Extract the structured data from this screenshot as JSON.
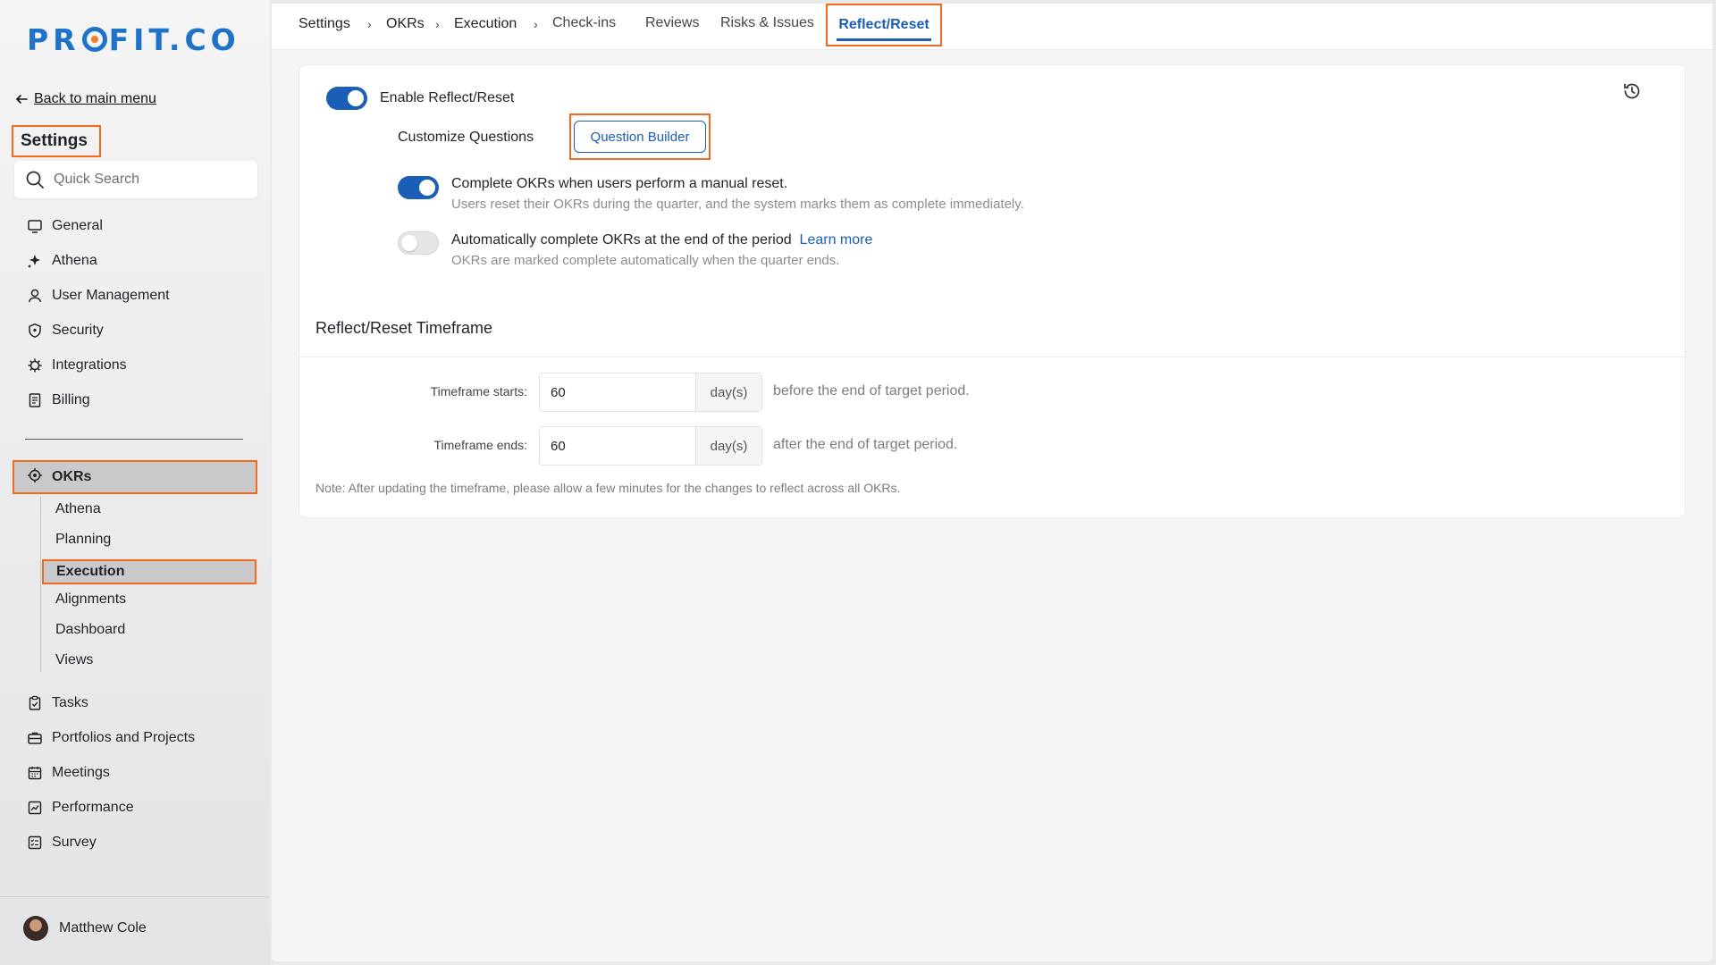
{
  "brand": {
    "logo_left": "PR",
    "logo_right": "FIT.CO"
  },
  "sidebar": {
    "back_label": "Back to main menu",
    "section_title": "Settings",
    "search_placeholder": "Quick Search",
    "items": [
      {
        "label": "General",
        "icon": "monitor-icon"
      },
      {
        "label": "Athena",
        "icon": "sparkle-icon"
      },
      {
        "label": "User Management",
        "icon": "user-icon"
      },
      {
        "label": "Security",
        "icon": "shield-icon"
      },
      {
        "label": "Integrations",
        "icon": "gear-icon"
      },
      {
        "label": "Billing",
        "icon": "receipt-icon"
      }
    ],
    "okrs": {
      "label": "OKRs",
      "icon": "target-icon"
    },
    "okr_sub": [
      "Athena",
      "Planning",
      "Execution",
      "Alignments",
      "Dashboard",
      "Views"
    ],
    "bottom_items": [
      {
        "label": "Tasks",
        "icon": "clipboard-icon"
      },
      {
        "label": "Portfolios and Projects",
        "icon": "briefcase-icon"
      },
      {
        "label": "Meetings",
        "icon": "calendar-icon"
      },
      {
        "label": "Performance",
        "icon": "chart-icon"
      },
      {
        "label": "Survey",
        "icon": "list-icon"
      }
    ],
    "user_name": "Matthew Cole"
  },
  "breadcrumb": [
    "Settings",
    "OKRs",
    "Execution"
  ],
  "tabs": [
    "Check-ins",
    "Reviews",
    "Risks & Issues",
    "Reflect/Reset"
  ],
  "settings": {
    "enable_label": "Enable Reflect/Reset",
    "enable_on": true,
    "customize_label": "Customize Questions",
    "question_builder": "Question Builder",
    "manual_reset_label": "Complete OKRs when users perform a manual reset.",
    "manual_reset_desc": "Users reset their OKRs during the quarter, and the system marks them as complete immediately.",
    "manual_reset_on": true,
    "auto_complete_label": "Automatically complete OKRs at the end of the period",
    "learn_more": "Learn more",
    "auto_complete_desc": "OKRs are marked complete automatically when the quarter ends.",
    "auto_complete_on": false
  },
  "timeframe": {
    "title": "Reflect/Reset Timeframe",
    "starts_label": "Timeframe starts:",
    "starts_value": "60",
    "starts_unit": "day(s)",
    "starts_suffix": "before the end of target period.",
    "ends_label": "Timeframe ends:",
    "ends_value": "60",
    "ends_unit": "day(s)",
    "ends_suffix": "after the end of target period.",
    "note": "Note: After updating the timeframe, please allow a few minutes for the changes to reflect across all OKRs."
  },
  "colors": {
    "accent": "#1b5eb6",
    "highlight": "#f26a1b",
    "logo": "#1e73c9"
  }
}
